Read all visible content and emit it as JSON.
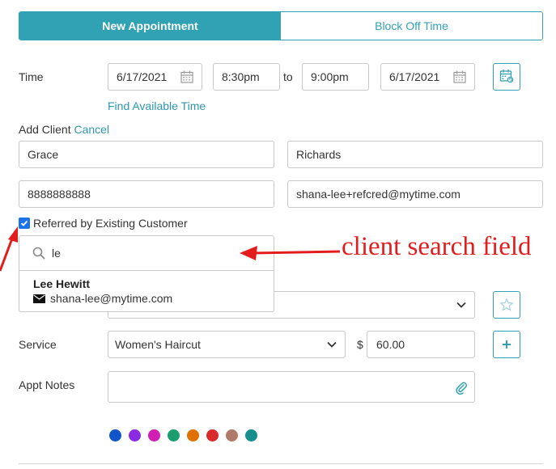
{
  "tabs": [
    {
      "label": "New Appointment",
      "active": true
    },
    {
      "label": "Block Off Time",
      "active": false
    }
  ],
  "time": {
    "label": "Time",
    "start_date": "6/17/2021",
    "start_time": "8:30pm",
    "to": "to",
    "end_time": "9:00pm",
    "end_date": "6/17/2021",
    "find_link": "Find Available Time"
  },
  "add_client": {
    "label": "Add Client",
    "cancel": "Cancel",
    "first_name": "Grace",
    "last_name": "Richards",
    "phone": "8888888888",
    "email": "shana-lee+refcred@mytime.com"
  },
  "referred": {
    "checked": true,
    "label": "Referred by Existing Customer"
  },
  "client_search": {
    "value": "le",
    "results": [
      {
        "name": "Lee Hewitt",
        "email": "shana-lee@mytime.com"
      }
    ]
  },
  "service": {
    "label": "Service",
    "selected": "Women's Haircut",
    "currency": "$",
    "price": "60.00"
  },
  "notes": {
    "label": "Appt Notes",
    "value": ""
  },
  "colors": [
    "#1155cc",
    "#8a2be2",
    "#d11fb4",
    "#1a9e6e",
    "#e07000",
    "#d92b2b",
    "#b07a6a",
    "#178f8f"
  ],
  "annotation": {
    "text": "client search field",
    "color": "#e31d1d"
  }
}
